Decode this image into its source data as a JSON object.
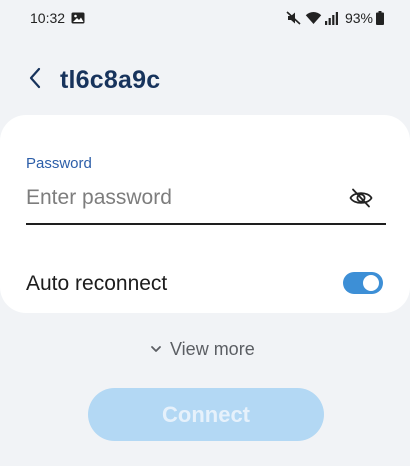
{
  "status_bar": {
    "time": "10:32",
    "battery_percent": "93%",
    "icons": [
      "gallery-icon",
      "mute-icon",
      "wifi-icon",
      "signal-icon",
      "battery-icon"
    ]
  },
  "header": {
    "back_icon": "chevron-left-icon",
    "network_name": "tl6c8a9c"
  },
  "form": {
    "password_label": "Password",
    "password_value": "",
    "password_placeholder": "Enter password",
    "show_password_icon": "eye-off-icon",
    "auto_reconnect_label": "Auto reconnect",
    "auto_reconnect_on": true
  },
  "view_more": {
    "label": "View more",
    "icon": "chevron-down-icon"
  },
  "connect_label": "Connect",
  "colors": {
    "background": "#f1f3f6",
    "card": "#ffffff",
    "title": "#17335c",
    "accent": "#3d8fd6",
    "label_blue": "#2c5ea8",
    "connect_disabled": "#b3d8f4"
  }
}
